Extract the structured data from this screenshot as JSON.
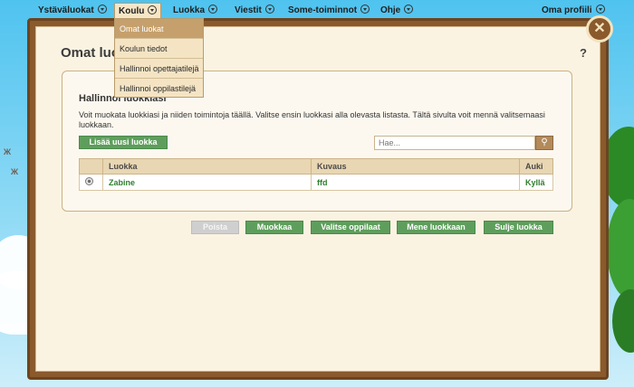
{
  "nav": {
    "items": [
      {
        "label": "Ystäväluokat"
      },
      {
        "label": "Koulu"
      },
      {
        "label": "Luokka"
      },
      {
        "label": "Viestit"
      },
      {
        "label": "Some-toiminnot"
      },
      {
        "label": "Ohje"
      },
      {
        "label": "Oma profiili"
      }
    ]
  },
  "dropdown": {
    "items": [
      {
        "label": "Omat luokat"
      },
      {
        "label": "Koulun tiedot"
      },
      {
        "label": "Hallinnoi opettajatilejä"
      },
      {
        "label": "Hallinnoi oppilastilejä"
      }
    ]
  },
  "page": {
    "title": "Omat luokat",
    "help": "?",
    "close": "✕",
    "section_heading": "Hallinnoi luokkiasi",
    "description": "Voit muokata luokkiasi ja niiden toimintoja täällä. Valitse ensin luokkasi alla olevasta listasta. Tältä sivulta voit mennä valitsemaasi luokkaan.",
    "add_class_label": "Lisää uusi luokka",
    "search_placeholder": "Hae..."
  },
  "table": {
    "headers": [
      "Luokka",
      "Kuvaus",
      "Auki"
    ],
    "rows": [
      {
        "name": "Zabine",
        "description": "ffd",
        "open": "Kyllä"
      }
    ]
  },
  "actions": {
    "delete": "Poista",
    "edit": "Muokkaa",
    "select_students": "Valitse oppilaat",
    "go_to_class": "Mene luokkaan",
    "close_class": "Sulje luokka"
  },
  "colors": {
    "frame": "#8a5a2c",
    "panel": "#fbf3e2",
    "button_green": "#5e9e5c",
    "sky": "#4fc3ef"
  }
}
